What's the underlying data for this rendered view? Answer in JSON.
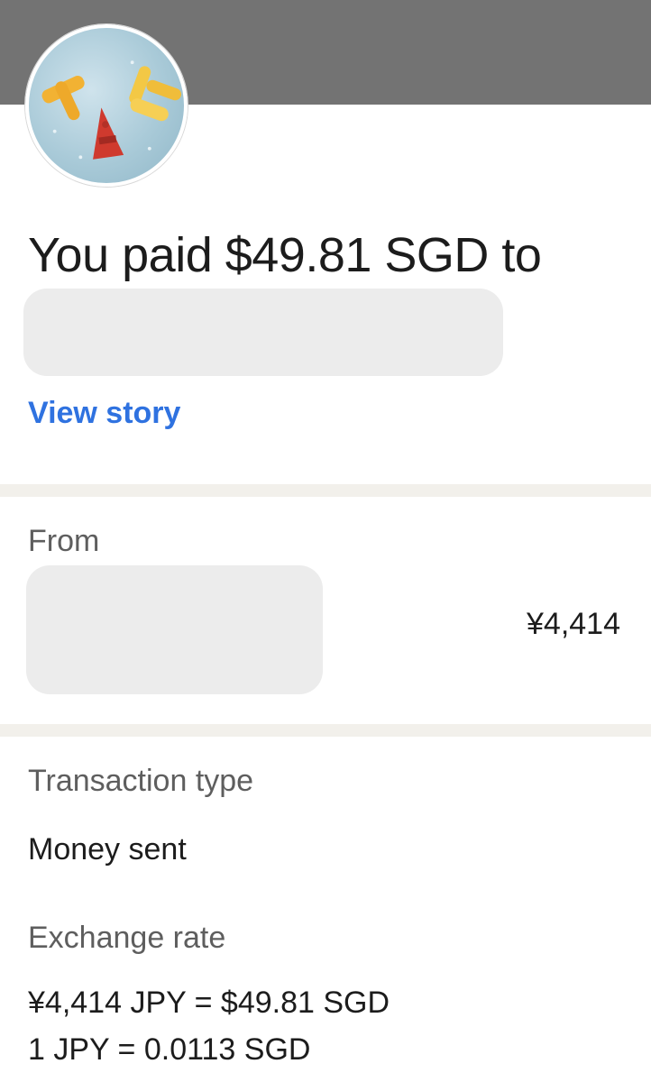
{
  "header": {
    "avatar_icon": "profile-photo-letters-icon"
  },
  "summary": {
    "headline": "You paid $49.81 SGD to",
    "view_story_label": "View story"
  },
  "from_section": {
    "label": "From",
    "amount": "¥4,414"
  },
  "transaction_type": {
    "label": "Transaction type",
    "value": "Money sent"
  },
  "exchange_rate": {
    "label": "Exchange rate",
    "line1": "¥4,414 JPY = $49.81 SGD",
    "line2": "1 JPY = 0.0113 SGD"
  },
  "colors": {
    "accent_link": "#2f72e0",
    "header_bar": "#737373",
    "divider": "#f2f0eb",
    "redaction": "#ececec"
  }
}
